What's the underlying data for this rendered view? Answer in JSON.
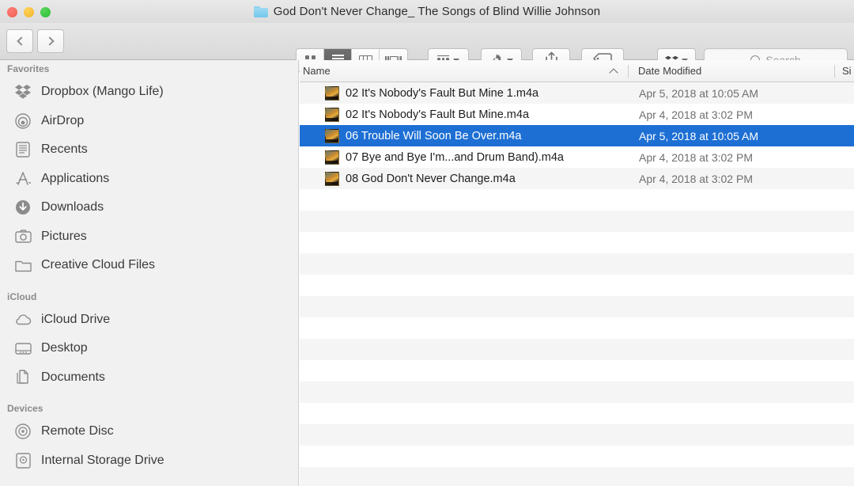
{
  "window": {
    "title": "God Don't Never Change_ The Songs of Blind Willie Johnson",
    "folder_icon": "folder-icon",
    "traffic_lights": [
      {
        "name": "close-button",
        "color": "#ec5f53"
      },
      {
        "name": "minimize-button",
        "color": "#f0b32c"
      },
      {
        "name": "zoom-button",
        "color": "#2cbb34"
      }
    ]
  },
  "toolbar": {
    "back_label": "Back",
    "forward_label": "Forward",
    "view_modes": [
      {
        "name": "icon-view",
        "icon": "grid-icon",
        "active": false
      },
      {
        "name": "list-view",
        "icon": "list-icon",
        "active": true
      },
      {
        "name": "column-view",
        "icon": "columns-icon",
        "active": false
      },
      {
        "name": "cover-flow-view",
        "icon": "coverflow-icon",
        "active": false
      }
    ],
    "arrange_label": "Arrange",
    "action_label": "Action",
    "share_label": "Share",
    "tag_label": "Edit Tags",
    "dropbox_label": "Dropbox"
  },
  "search": {
    "placeholder": "Search",
    "value": "",
    "icon": "search-icon"
  },
  "sidebar": {
    "sections": [
      {
        "header": "Favorites",
        "items": [
          {
            "label": "Dropbox (Mango Life)",
            "icon": "dropbox-icon"
          },
          {
            "label": "AirDrop",
            "icon": "airdrop-icon"
          },
          {
            "label": "Recents",
            "icon": "recents-icon"
          },
          {
            "label": "Applications",
            "icon": "applications-icon"
          },
          {
            "label": "Downloads",
            "icon": "downloads-icon"
          },
          {
            "label": "Pictures",
            "icon": "pictures-icon"
          },
          {
            "label": "Creative Cloud Files",
            "icon": "folder-icon"
          }
        ]
      },
      {
        "header": "iCloud",
        "items": [
          {
            "label": "iCloud Drive",
            "icon": "cloud-icon"
          },
          {
            "label": "Desktop",
            "icon": "desktop-icon"
          },
          {
            "label": "Documents",
            "icon": "documents-icon"
          }
        ]
      },
      {
        "header": "Devices",
        "items": [
          {
            "label": "Remote Disc",
            "icon": "disc-icon"
          },
          {
            "label": "Internal Storage Drive",
            "icon": "harddrive-icon"
          }
        ]
      }
    ]
  },
  "file_list": {
    "columns": [
      {
        "label": "Name",
        "sorted": true,
        "sort_direction": "ascending"
      },
      {
        "label": "Date Modified",
        "sorted": false
      },
      {
        "label": "Si",
        "sorted": false
      }
    ],
    "rows": [
      {
        "name": "02 It's Nobody's Fault But Mine 1.m4a",
        "date": "Apr 5, 2018 at 10:05 AM",
        "selected": false
      },
      {
        "name": "02 It's Nobody's Fault But Mine.m4a",
        "date": "Apr 4, 2018 at 3:02 PM",
        "selected": false
      },
      {
        "name": "06 Trouble Will Soon Be Over.m4a",
        "date": "Apr 5, 2018 at 10:05 AM",
        "selected": true
      },
      {
        "name": "07 Bye and Bye I'm...and Drum Band).m4a",
        "date": "Apr 4, 2018 at 3:02 PM",
        "selected": false
      },
      {
        "name": "08 God Don't Never Change.m4a",
        "date": "Apr 4, 2018 at 3:02 PM",
        "selected": false
      }
    ],
    "empty_row_count": 14
  },
  "colors": {
    "selection_blue": "#1d6fd4",
    "sidebar_background": "#f1f1f1",
    "toolbar_background": "#e0e0e0",
    "stripe_gray": "#f5f5f5"
  }
}
